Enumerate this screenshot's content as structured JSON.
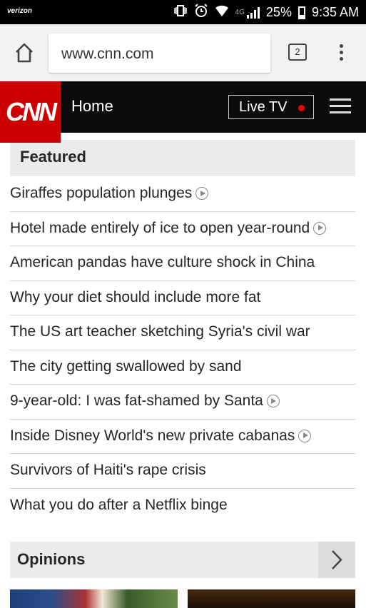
{
  "status_bar": {
    "carrier": "verizon",
    "network": "4G",
    "battery": "25%",
    "time": "9:35 AM"
  },
  "browser": {
    "url": "www.cnn.com",
    "tab_count": "2"
  },
  "cnn_header": {
    "logo": "CNN",
    "home_label": "Home",
    "live_tv_label": "Live TV",
    "live_dot_color": "#e00000"
  },
  "featured": {
    "title": "Featured",
    "items": [
      {
        "text": "Giraffes population plunges",
        "video": true
      },
      {
        "text": "Hotel made entirely of ice to open year-round",
        "video": true
      },
      {
        "text": "American pandas have culture shock in China",
        "video": false
      },
      {
        "text": "Why your diet should include more fat",
        "video": false
      },
      {
        "text": "The US art teacher sketching Syria's civil war",
        "video": false
      },
      {
        "text": "The city getting swallowed by sand",
        "video": false
      },
      {
        "text": "9-year-old: I was fat-shamed by Santa",
        "video": true
      },
      {
        "text": "Inside Disney World's new private cabanas",
        "video": true
      },
      {
        "text": "Survivors of Haiti's rape crisis",
        "video": false
      },
      {
        "text": "What you do after a Netflix binge",
        "video": false
      }
    ]
  },
  "opinions": {
    "title": "Opinions"
  },
  "colors": {
    "cnn_red": "#cc0000",
    "header_bg": "#0c0c0c",
    "section_bg": "#ebebeb"
  }
}
